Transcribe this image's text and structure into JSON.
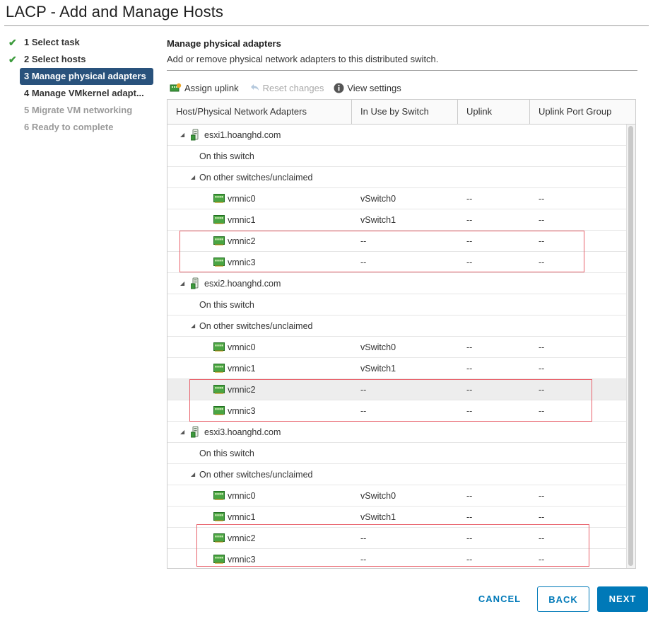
{
  "dialog": {
    "title": "LACP - Add and Manage Hosts"
  },
  "steps": [
    {
      "label": "1 Select task",
      "state": "done"
    },
    {
      "label": "2 Select hosts",
      "state": "done"
    },
    {
      "label": "3 Manage physical adapters",
      "state": "active"
    },
    {
      "label": "4 Manage VMkernel adapt...",
      "state": "normal"
    },
    {
      "label": "5 Migrate VM networking",
      "state": "disabled"
    },
    {
      "label": "6 Ready to complete",
      "state": "disabled"
    }
  ],
  "section": {
    "title": "Manage physical adapters",
    "description": "Add or remove physical network adapters to this distributed switch."
  },
  "toolbar": {
    "assign_uplink": "Assign uplink",
    "reset_changes": "Reset changes",
    "view_settings": "View settings"
  },
  "table": {
    "columns": [
      "Host/Physical Network Adapters",
      "In Use by Switch",
      "Uplink",
      "Uplink Port Group"
    ],
    "rows": [
      {
        "kind": "host",
        "name": "esxi1.hoanghd.com"
      },
      {
        "kind": "group",
        "name": "On this switch",
        "expandable": false
      },
      {
        "kind": "group",
        "name": "On other switches/unclaimed",
        "expandable": true
      },
      {
        "kind": "nic",
        "name": "vmnic0",
        "in_use": "vSwitch0",
        "uplink": "--",
        "port_group": "--"
      },
      {
        "kind": "nic",
        "name": "vmnic1",
        "in_use": "vSwitch1",
        "uplink": "--",
        "port_group": "--"
      },
      {
        "kind": "nic",
        "name": "vmnic2",
        "in_use": "--",
        "uplink": "--",
        "port_group": "--"
      },
      {
        "kind": "nic",
        "name": "vmnic3",
        "in_use": "--",
        "uplink": "--",
        "port_group": "--"
      },
      {
        "kind": "host",
        "name": "esxi2.hoanghd.com"
      },
      {
        "kind": "group",
        "name": "On this switch",
        "expandable": false
      },
      {
        "kind": "group",
        "name": "On other switches/unclaimed",
        "expandable": true
      },
      {
        "kind": "nic",
        "name": "vmnic0",
        "in_use": "vSwitch0",
        "uplink": "--",
        "port_group": "--"
      },
      {
        "kind": "nic",
        "name": "vmnic1",
        "in_use": "vSwitch1",
        "uplink": "--",
        "port_group": "--"
      },
      {
        "kind": "nic",
        "name": "vmnic2",
        "in_use": "--",
        "uplink": "--",
        "port_group": "--",
        "selected": true
      },
      {
        "kind": "nic",
        "name": "vmnic3",
        "in_use": "--",
        "uplink": "--",
        "port_group": "--"
      },
      {
        "kind": "host",
        "name": "esxi3.hoanghd.com"
      },
      {
        "kind": "group",
        "name": "On this switch",
        "expandable": false
      },
      {
        "kind": "group",
        "name": "On other switches/unclaimed",
        "expandable": true
      },
      {
        "kind": "nic",
        "name": "vmnic0",
        "in_use": "vSwitch0",
        "uplink": "--",
        "port_group": "--"
      },
      {
        "kind": "nic",
        "name": "vmnic1",
        "in_use": "vSwitch1",
        "uplink": "--",
        "port_group": "--"
      },
      {
        "kind": "nic",
        "name": "vmnic2",
        "in_use": "--",
        "uplink": "--",
        "port_group": "--"
      },
      {
        "kind": "nic",
        "name": "vmnic3",
        "in_use": "--",
        "uplink": "--",
        "port_group": "--"
      }
    ]
  },
  "buttons": {
    "cancel": "CANCEL",
    "back": "BACK",
    "next": "NEXT"
  },
  "colors": {
    "accent": "#0079b8",
    "active_step": "#29527c",
    "check": "#3c9b3c",
    "annotation": "#e8606a"
  }
}
